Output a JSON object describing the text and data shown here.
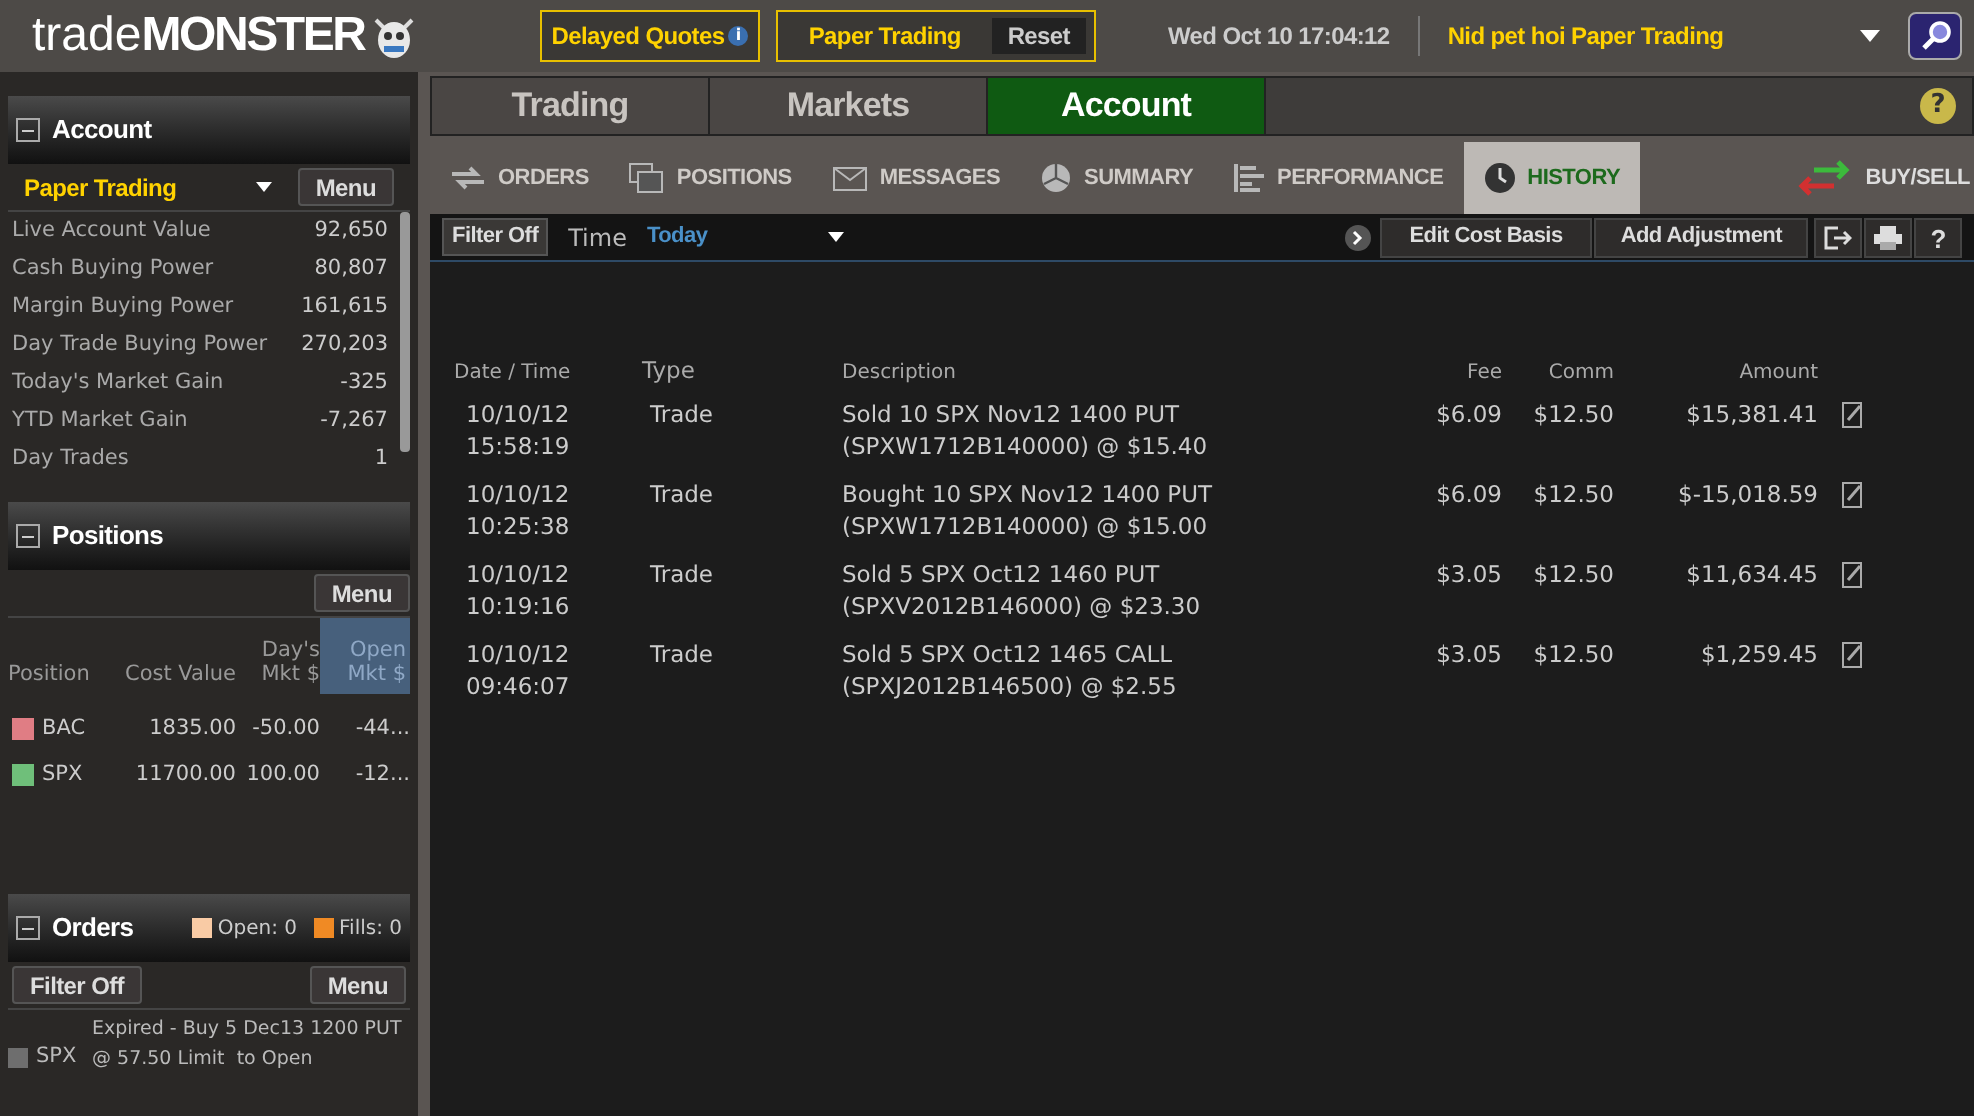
{
  "header": {
    "logo_light": "trade",
    "logo_bold": "MONSTER",
    "delayed_quotes": "Delayed Quotes",
    "info": "i",
    "paper_trading": "Paper Trading",
    "reset": "Reset",
    "datetime": "Wed Oct 10 17:04:12",
    "account_name": "Nid pet hoi Paper Trading"
  },
  "sidebar": {
    "account": {
      "title": "Account",
      "selector": "Paper Trading",
      "menu": "Menu",
      "rows": [
        {
          "label": "Live Account Value",
          "value": "92,650"
        },
        {
          "label": "Cash Buying Power",
          "value": "80,807"
        },
        {
          "label": "Margin Buying Power",
          "value": "161,615"
        },
        {
          "label": "Day Trade Buying Power",
          "value": "270,203"
        },
        {
          "label": "Today's Market Gain",
          "value": "-325"
        },
        {
          "label": "YTD Market Gain",
          "value": "-7,267"
        },
        {
          "label": "Day Trades",
          "value": "1"
        }
      ]
    },
    "positions": {
      "title": "Positions",
      "menu": "Menu",
      "columns": [
        {
          "label": "Position",
          "selected": false
        },
        {
          "label": "Cost Value",
          "selected": false
        },
        {
          "label": "Day's Mkt $",
          "selected": false
        },
        {
          "label": "Open Mkt $",
          "selected": true
        }
      ],
      "rows": [
        {
          "symbol": "BAC",
          "color": "#e07d84",
          "cost": "1835.00",
          "day": "-50.00",
          "open": "-44..."
        },
        {
          "symbol": "SPX",
          "color": "#6fbf7a",
          "cost": "11700.00",
          "day": "100.00",
          "open": "-12..."
        }
      ]
    },
    "orders": {
      "title": "Orders",
      "legend": [
        {
          "label": "Open: 0",
          "color": "#f9cba5"
        },
        {
          "label": "Fills: 0",
          "color": "#f08a24"
        }
      ],
      "filter": "Filter Off",
      "menu": "Menu",
      "rows": [
        {
          "symbol": "SPX",
          "color": "#6e6e6e",
          "text": "Expired - Buy 5 Dec13 1200 PUT @ 57.50 Limit  to Open"
        }
      ]
    }
  },
  "main_tabs": [
    {
      "label": "Trading",
      "selected": false
    },
    {
      "label": "Markets",
      "selected": false
    },
    {
      "label": "Account",
      "selected": true
    }
  ],
  "help": "?",
  "sub_tabs": [
    {
      "label": "ORDERS",
      "selected": false
    },
    {
      "label": "POSITIONS",
      "selected": false
    },
    {
      "label": "MESSAGES",
      "selected": false
    },
    {
      "label": "SUMMARY",
      "selected": false
    },
    {
      "label": "PERFORMANCE",
      "selected": false
    },
    {
      "label": "HISTORY",
      "selected": true
    }
  ],
  "buy_sell": "BUY/SELL",
  "toolbar": {
    "filter": "Filter Off",
    "time_label": "Time",
    "time_value": "Today",
    "edit_cost_basis": "Edit Cost Basis",
    "add_adjustment": "Add Adjustment",
    "help": "?"
  },
  "table": {
    "columns": [
      "Date / Time",
      "Type",
      "Description",
      "Fee",
      "Comm",
      "Amount"
    ],
    "rows": [
      {
        "date": "10/10/12",
        "time": "15:58:19",
        "type": "Trade",
        "desc1": "Sold 10 SPX Nov12 1400 PUT",
        "desc2": "(SPXW1712B140000) @ $15.40",
        "fee": "$6.09",
        "comm": "$12.50",
        "amount": "$15,381.41"
      },
      {
        "date": "10/10/12",
        "time": "10:25:38",
        "type": "Trade",
        "desc1": "Bought 10 SPX Nov12 1400 PUT",
        "desc2": "(SPXW1712B140000) @ $15.00",
        "fee": "$6.09",
        "comm": "$12.50",
        "amount": "$-15,018.59"
      },
      {
        "date": "10/10/12",
        "time": "10:19:16",
        "type": "Trade",
        "desc1": "Sold 5 SPX Oct12 1460 PUT",
        "desc2": "(SPXV2012B146000) @ $23.30",
        "fee": "$3.05",
        "comm": "$12.50",
        "amount": "$11,634.45"
      },
      {
        "date": "10/10/12",
        "time": "09:46:07",
        "type": "Trade",
        "desc1": "Sold 5 SPX Oct12 1465 CALL",
        "desc2": "(SPXJ2012B146500) @ $2.55",
        "fee": "$3.05",
        "comm": "$12.50",
        "amount": "$1,259.45"
      }
    ]
  }
}
